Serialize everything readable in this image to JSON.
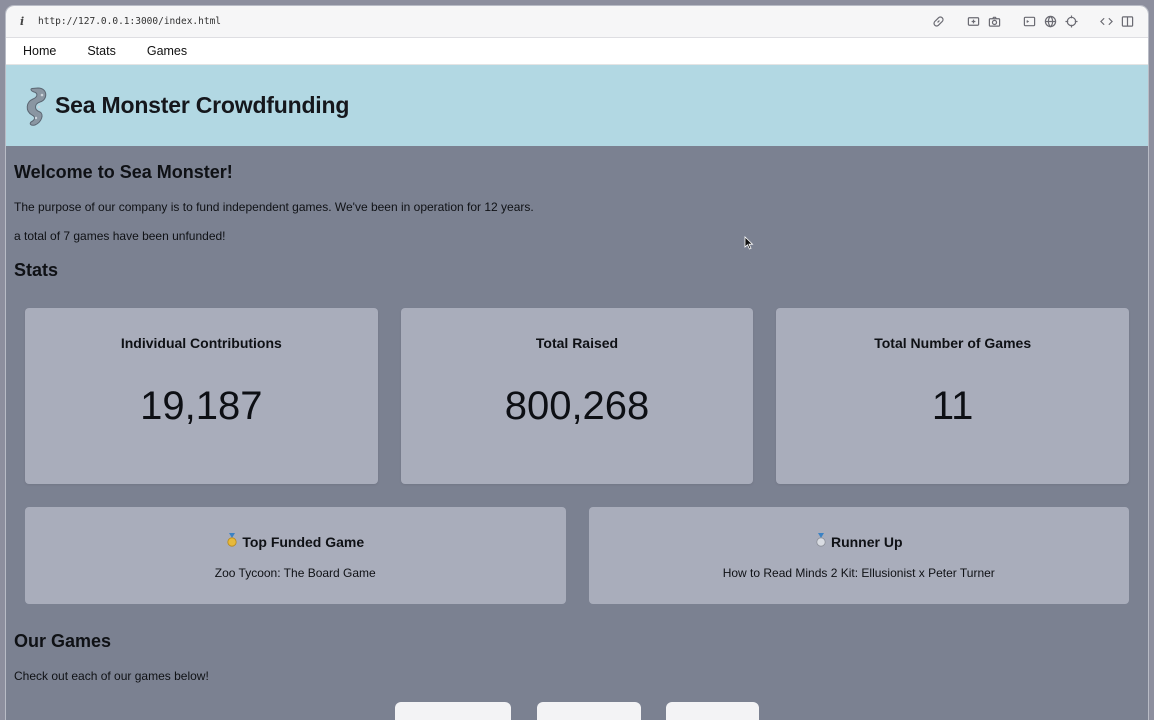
{
  "browser": {
    "url": "http://127.0.0.1:3000/index.html",
    "info_icon": "i",
    "toolbar_icons": [
      "link-icon",
      "screenshot-icon",
      "camera-icon",
      "console-icon",
      "globe-icon",
      "crosshair-icon",
      "code-icon",
      "split-view-icon"
    ]
  },
  "nav": {
    "items": [
      "Home",
      "Stats",
      "Games"
    ]
  },
  "hero": {
    "title": "Sea Monster Crowdfunding",
    "logo_icon": "tentacle-icon"
  },
  "welcome": {
    "heading": "Welcome to Sea Monster!",
    "intro": "The purpose of our company is to fund independent games. We've been in operation for 12 years.",
    "unfunded": "a total of 7 games have been unfunded!"
  },
  "stats": {
    "heading": "Stats",
    "cards": [
      {
        "label": "Individual Contributions",
        "value": "19,187"
      },
      {
        "label": "Total Raised",
        "value": "800,268"
      },
      {
        "label": "Total Number of Games",
        "value": "11"
      }
    ],
    "top_funded": {
      "label": "Top Funded Game",
      "name": "Zoo Tycoon: The Board Game",
      "icon": "gold-medal-icon"
    },
    "runner_up": {
      "label": "Runner Up",
      "name": "How to Read Minds 2 Kit: Ellusionist x Peter Turner",
      "icon": "silver-medal-icon"
    }
  },
  "games": {
    "heading": "Our Games",
    "subtitle": "Check out each of our games below!"
  },
  "colors": {
    "hero_bg": "#b2d8e3",
    "page_bg": "#7b8191",
    "card_bg": "#a9adbb"
  }
}
